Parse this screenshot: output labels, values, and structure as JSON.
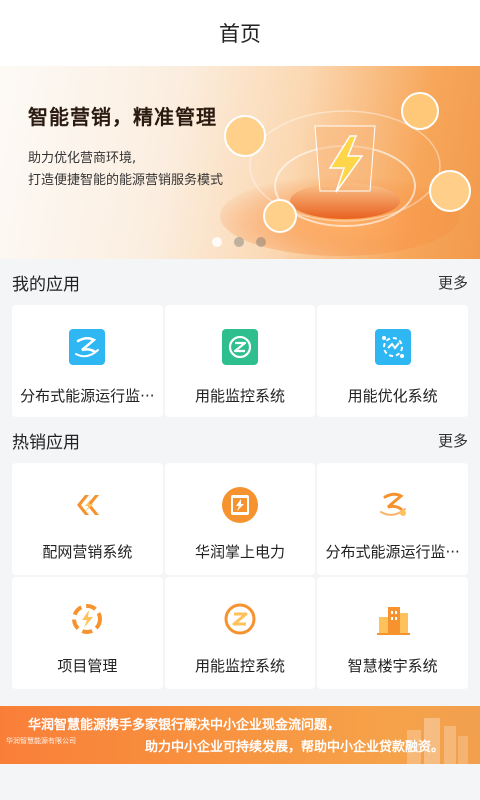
{
  "header": {
    "title": "首页"
  },
  "banner": {
    "title": "智能营销，精准管理",
    "subtitle_line1": "助力优化营商环境,",
    "subtitle_line2": "打造便捷智能的能源营销服务模式"
  },
  "my_apps": {
    "title": "我的应用",
    "more": "更多",
    "items": [
      {
        "label": "分布式能源运行监···",
        "icon": "distributed-energy-icon",
        "color": "#2fb7f3"
      },
      {
        "label": "用能监控系统",
        "icon": "energy-monitor-icon",
        "color": "#2fbf8f"
      },
      {
        "label": "用能优化系统",
        "icon": "energy-optimize-icon",
        "color": "#2fb7f3"
      }
    ]
  },
  "hot_apps": {
    "title": "热销应用",
    "more": "更多",
    "items": [
      {
        "label": "配网营销系统",
        "icon": "grid-marketing-icon"
      },
      {
        "label": "华润掌上电力",
        "icon": "mobile-power-icon"
      },
      {
        "label": "分布式能源运行监···",
        "icon": "distributed-energy-icon"
      },
      {
        "label": "项目管理",
        "icon": "project-management-icon"
      },
      {
        "label": "用能监控系统",
        "icon": "energy-monitor-icon"
      },
      {
        "label": "智慧楼宇系统",
        "icon": "smart-building-icon"
      }
    ]
  },
  "promo": {
    "line1": "华润智慧能源携手多家银行解决中小企业现金流问题，",
    "line2": "助力中小企业可持续发展，帮助中小企业贷款融资。",
    "logo_text": "华润智慧能源有限公司"
  },
  "colors": {
    "accent": "#f7932f",
    "background": "#f4f5f7"
  }
}
